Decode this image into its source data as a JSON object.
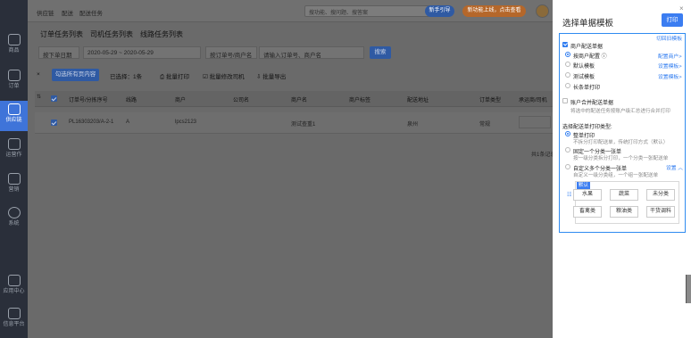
{
  "sidebar": {
    "items": [
      {
        "label": "商品",
        "icon": "shopping-bag-icon"
      },
      {
        "label": "订单",
        "icon": "order-icon"
      },
      {
        "label": "供应链",
        "icon": "supply-chain-icon"
      },
      {
        "label": "运营作",
        "icon": "operations-icon"
      },
      {
        "label": "营销",
        "icon": "marketing-icon"
      },
      {
        "label": "系统",
        "icon": "settings-icon"
      },
      {
        "label": "应用中心",
        "icon": "apps-icon"
      },
      {
        "label": "信息平台",
        "icon": "info-platform-icon"
      }
    ],
    "active_index": 2
  },
  "topbar": {
    "breadcrumb": [
      "供应链",
      "配送",
      "配送任务"
    ],
    "search_placeholder": "搜功能、搜问题、搜答案",
    "pill_1": "新手引导",
    "pill_2": "新功能上线，点击查看"
  },
  "tabs": [
    "订单任务列表",
    "司机任务列表",
    "线路任务列表"
  ],
  "filters": {
    "date_type": "按下单日期",
    "date_range": "2020-05-29 ~ 2020-05-29",
    "search_type": "按订单号/商户名",
    "search_placeholder": "请输入订单号、商户名",
    "search_button": "搜索"
  },
  "toolbar": {
    "close": "×",
    "select_all_pages": "勾选所有页内容",
    "selected": "已选择：1条",
    "batch_print": "批量打印",
    "batch_change_driver": "批量修改司机",
    "batch_export": "批量导出"
  },
  "table": {
    "columns": [
      "订单号/分拣序号",
      "线路",
      "商户",
      "公司名",
      "商户名",
      "商户标签",
      "配送地址",
      "订单类型",
      "承运商/司机"
    ],
    "rows": [
      [
        "PL16303203/A-2-1",
        "A",
        "lpcs2123",
        "",
        "测试查重1",
        "",
        "泉州",
        "常规",
        ""
      ]
    ]
  },
  "pager": "共1条记录，每页",
  "drawer": {
    "title": "选择单据模板",
    "close": "×",
    "print_button": "打印",
    "switch_old": "切回旧模板",
    "merchant_delivery_label": "商户配送单据",
    "by_merchant_config": "按商户配置",
    "config_merchant_link": "配置商户>",
    "default_template": "默认模板",
    "set_template_link_1": "设置模板>",
    "test_template": "测试模板",
    "set_template_link_2": "设置模板>",
    "long_strip_print": "长条单打印",
    "account_merge_label": "账户合并配送单据",
    "account_merge_desc": "将选中的配送任务按账户级汇总进行合并打印",
    "category_print_type_label": "选择配送单打印类型:",
    "whole_print": "整单打印",
    "whole_print_desc": "不拆分打印配送单，传统打印方式（默认）",
    "fixed_category": "固定一个分类一张单",
    "fixed_category_desc": "按一级分类拆分打印，一个分类一张配送单",
    "custom_categories": "自定义多个分类一张单",
    "custom_categories_desc": "自定义一级分类组，一个组一张配送单",
    "settings_link": "设置",
    "default_tag": "默认",
    "categories": [
      "水果",
      "蔬菜",
      "未分类",
      "畜禽类",
      "粮油类",
      "干货调料"
    ]
  }
}
